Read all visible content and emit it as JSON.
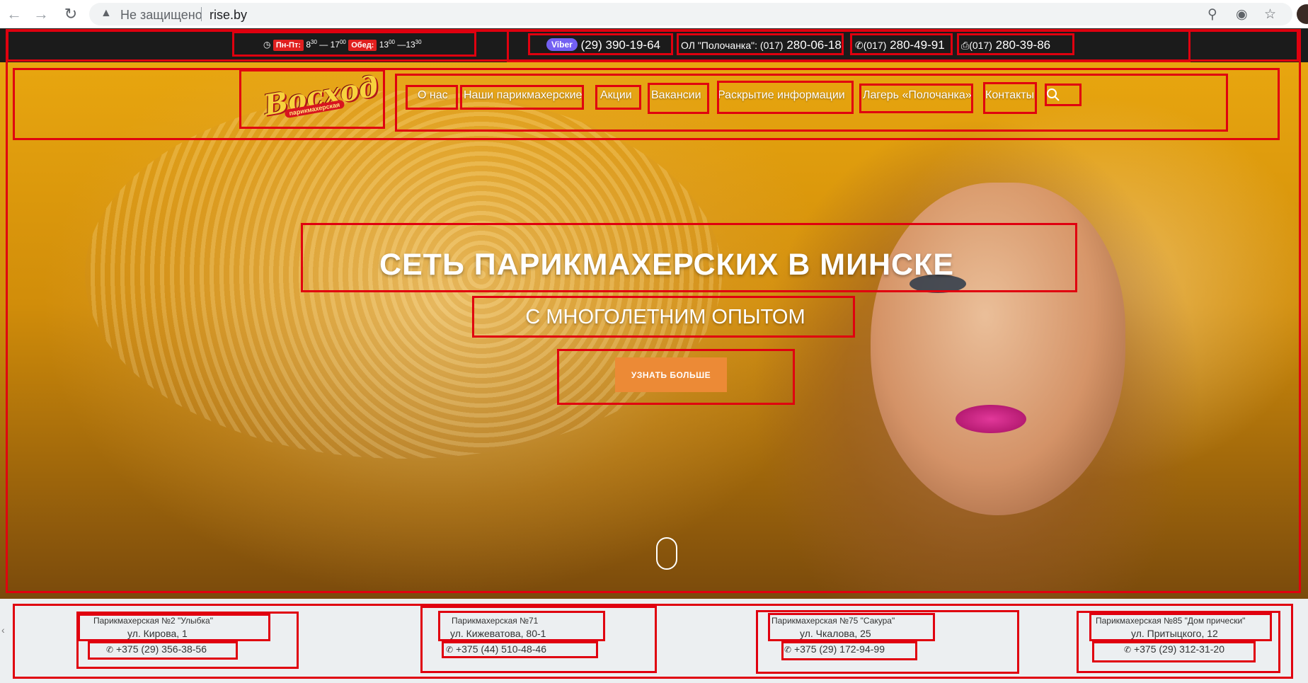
{
  "browser": {
    "security_label": "Не защищено",
    "url": "rise.by"
  },
  "topbar": {
    "days_label": "Пн-Пт:",
    "work_from_h": "8",
    "work_from_m": "30",
    "dash": "—",
    "work_to_h": "17",
    "work_to_m": "00",
    "lunch_label": "Обед:",
    "lunch_from_h": "13",
    "lunch_from_m": "00",
    "lunch_to_h": "13",
    "lunch_to_m": "30",
    "viber_label": "Viber",
    "viber_code": "(29)",
    "viber_number": "390-19-64",
    "camp_prefix": "ОЛ \"Полочанка\": (017)",
    "camp_number": "280-06-18",
    "phone_code": "(017)",
    "phone_number": "280-49-91",
    "fax_code": "(017)",
    "fax_number": "280-39-86"
  },
  "logo": {
    "name": "Восход",
    "subtitle": "парикмахерская"
  },
  "nav": {
    "items": [
      "О нас",
      "Наши парикмахерские",
      "Акции",
      "Вакансии",
      "Раскрытие информации",
      "Лагерь «Полочанка»",
      "Контакты"
    ]
  },
  "hero": {
    "title": "СЕТЬ ПАРИКМАХЕРСКИХ В МИНСКЕ",
    "subtitle": "С МНОГОЛЕТНИМ ОПЫТОМ",
    "cta_label": "УЗНАТЬ БОЛЬШЕ"
  },
  "salons": [
    {
      "name": "Парикмахерская №2 \"Улыбка\"",
      "address": "ул. Кирова, 1",
      "phone": "+375 (29) 356-38-56"
    },
    {
      "name": "Парикмахерская №71",
      "address": "ул. Кижеватова, 80-1",
      "phone": "+375 (44) 510-48-46"
    },
    {
      "name": "Парикмахерская №75 \"Сакура\"",
      "address": "ул. Чкалова, 25",
      "phone": "+375 (29) 172-94-99"
    },
    {
      "name": "Парикмахерская №85 \"Дом прически\"",
      "address": "ул. Притыцкого, 12",
      "phone": "+375 (29) 312-31-20"
    }
  ],
  "colors": {
    "annotation_box": "#e0000f",
    "topbar_bg": "#1b1b1b",
    "accent_red": "#e0201f",
    "viber_purple": "#7360f2",
    "cta_orange": "#ec8a36",
    "hero_gold": "#e8a60f"
  }
}
